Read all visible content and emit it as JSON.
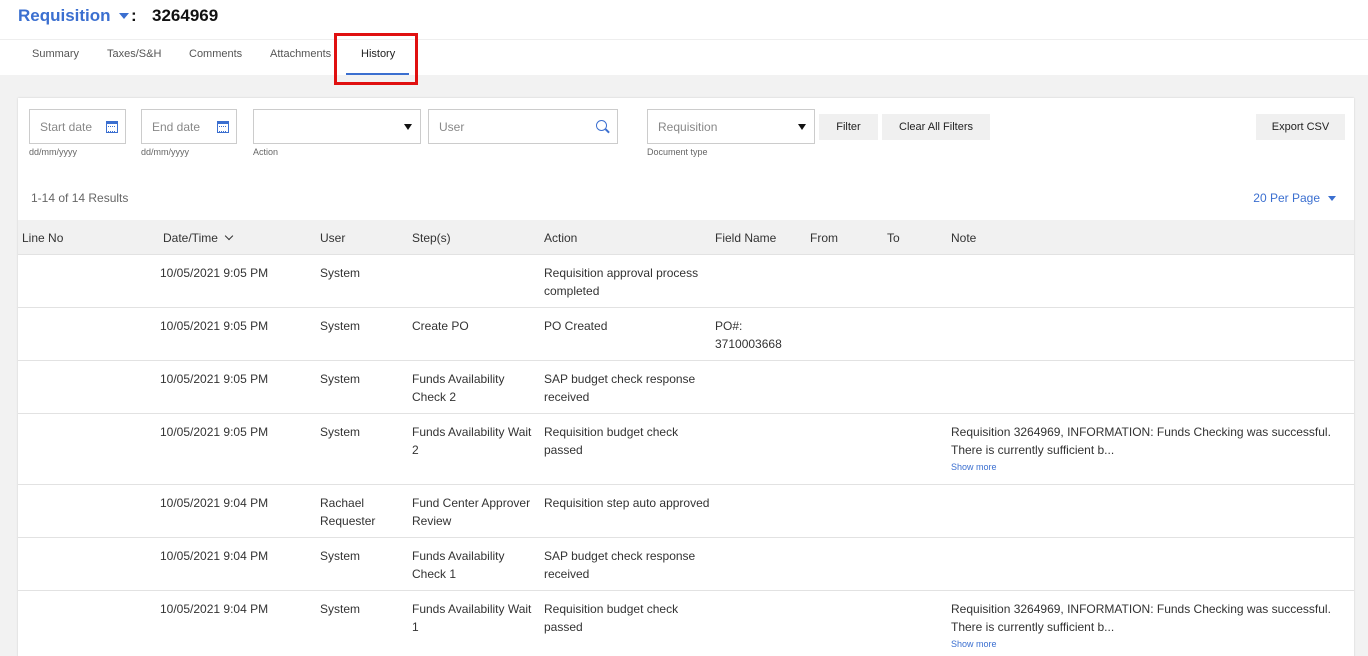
{
  "header": {
    "doc_type": "Requisition",
    "separator": ":",
    "doc_number": "3264969"
  },
  "tabs": [
    {
      "label": "Summary"
    },
    {
      "label": "Taxes/S&H"
    },
    {
      "label": "Comments"
    },
    {
      "label": "Attachments"
    },
    {
      "label": "History",
      "active": true
    }
  ],
  "filters": {
    "start_date": {
      "placeholder": "Start date",
      "hint": "dd/mm/yyyy"
    },
    "end_date": {
      "placeholder": "End date",
      "hint": "dd/mm/yyyy"
    },
    "action": {
      "value": "",
      "hint": "Action"
    },
    "user": {
      "placeholder": "User"
    },
    "document_type": {
      "value": "Requisition",
      "hint": "Document type"
    },
    "filter_button": "Filter",
    "clear_button": "Clear All Filters",
    "export_button": "Export CSV"
  },
  "results_text": "1-14 of 14 Results",
  "per_page": "20 Per Page",
  "columns": [
    "Line No",
    "Date/Time",
    "User",
    "Step(s)",
    "Action",
    "Field Name",
    "From",
    "To",
    "Note"
  ],
  "rows": [
    {
      "line": "",
      "datetime": "10/05/2021 9:05 PM",
      "user": "System",
      "step": "",
      "action": "Requisition approval process completed",
      "field": "",
      "from": "",
      "to": "",
      "note": "",
      "show_more": ""
    },
    {
      "line": "",
      "datetime": "10/05/2021 9:05 PM",
      "user": "System",
      "step": "Create PO",
      "action": "PO Created",
      "field": "PO#: 3710003668",
      "from": "",
      "to": "",
      "note": "",
      "show_more": ""
    },
    {
      "line": "",
      "datetime": "10/05/2021 9:05 PM",
      "user": "System",
      "step": "Funds Availability Check 2",
      "action": "SAP budget check response received",
      "field": "",
      "from": "",
      "to": "",
      "note": "",
      "show_more": ""
    },
    {
      "line": "",
      "datetime": "10/05/2021 9:05 PM",
      "user": "System",
      "step": "Funds Availability Wait 2",
      "action": "Requisition budget check passed",
      "field": "",
      "from": "",
      "to": "",
      "note": "Requisition 3264969, INFORMATION: Funds Checking was successful. There is currently sufficient b...",
      "show_more": "Show more"
    },
    {
      "line": "",
      "datetime": "10/05/2021 9:04 PM",
      "user": "Rachael Requester",
      "step": "Fund Center Approver Review",
      "action": "Requisition step auto approved",
      "field": "",
      "from": "",
      "to": "",
      "note": "",
      "show_more": ""
    },
    {
      "line": "",
      "datetime": "10/05/2021 9:04 PM",
      "user": "System",
      "step": "Funds Availability Check 1",
      "action": "SAP budget check response received",
      "field": "",
      "from": "",
      "to": "",
      "note": "",
      "show_more": ""
    },
    {
      "line": "",
      "datetime": "10/05/2021 9:04 PM",
      "user": "System",
      "step": "Funds Availability Wait 1",
      "action": "Requisition budget check passed",
      "field": "",
      "from": "",
      "to": "",
      "note": "Requisition 3264969, INFORMATION: Funds Checking was successful. There is currently sufficient b...",
      "show_more": "Show more"
    }
  ],
  "colors": {
    "accent": "#3b6fd0",
    "highlight": "#e01010"
  }
}
